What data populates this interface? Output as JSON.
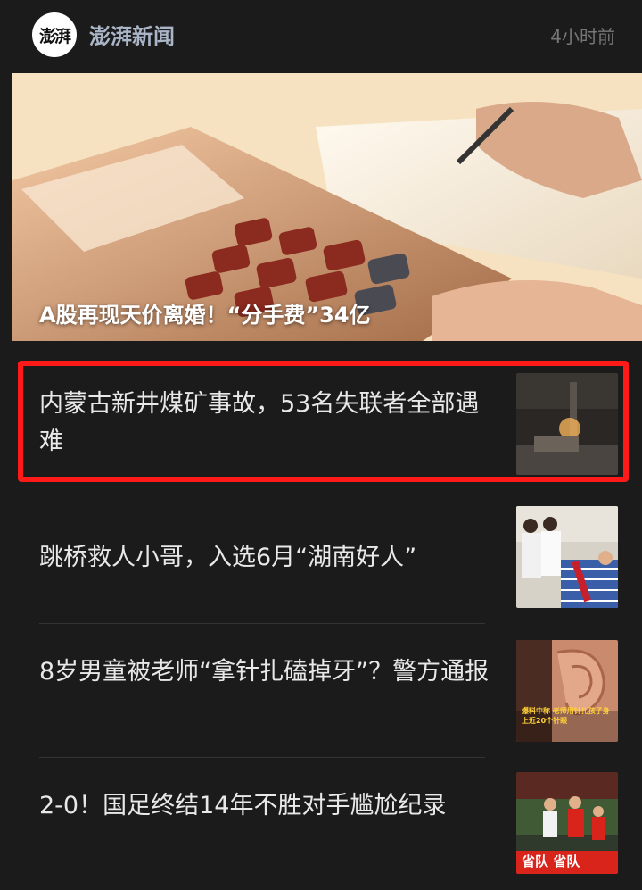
{
  "header": {
    "logo_text": "澎湃",
    "source": "澎湃新闻",
    "time": "4小时前"
  },
  "hero": {
    "title": "A股再现天价离婚！“分手费”34亿"
  },
  "items": [
    {
      "title": "内蒙古新井煤矿事故，53名失联者全部遇难",
      "thumb_icon": "mine-rescue-photo",
      "highlighted": true
    },
    {
      "title": "跳桥救人小哥，入选6月“湖南好人”",
      "thumb_icon": "hospital-visit-photo"
    },
    {
      "title": "8岁男童被老师“拿针扎磕掉牙”？警方通报",
      "thumb_icon": "ear-closeup-photo",
      "thumb_caption": "爆料中称 老师用针扎孩子身上近20个针眼"
    },
    {
      "title": "2-0！国足终结14年不胜对手尴尬纪录",
      "thumb_icon": "football-match-photo",
      "thumb_caption": "省队 省队"
    }
  ],
  "colors": {
    "background": "#1b1b1b",
    "highlight": "#ff1a1a",
    "source": "#aab6c8"
  }
}
